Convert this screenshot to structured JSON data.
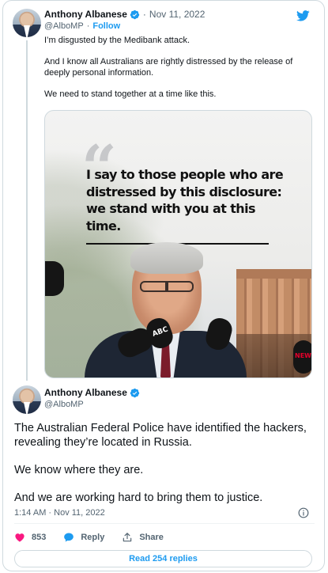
{
  "colors": {
    "accent": "#1d9bf0",
    "text": "#0f1419",
    "muted": "#536471",
    "like": "#f91880",
    "border": "#cfd9de"
  },
  "parent_tweet": {
    "author_name": "Anthony Albanese",
    "handle": "@AlboMP",
    "date": "Nov 11, 2022",
    "separator": "·",
    "follow_label": "Follow",
    "paragraphs": [
      "I’m disgusted by the Medibank attack.",
      "And I know all Australians are rightly distressed by the release of deeply personal information.",
      "We need to stand together at a time like this."
    ],
    "media": {
      "quote_mark": "“",
      "quote_text": "I say to those people who are distressed by this disclosure: we stand with you at this time.",
      "mic_labels": [
        "ABC",
        "NEWS"
      ]
    }
  },
  "main_tweet": {
    "author_name": "Anthony Albanese",
    "handle": "@AlboMP",
    "paragraphs": [
      "The Australian Federal Police have identified the hackers, revealing they’re located in Russia.",
      "We know where they are.",
      "And we are working hard to bring them to justice."
    ],
    "timestamp": "1:14 AM · Nov 11, 2022",
    "actions": {
      "likes_count": "853",
      "reply_label": "Reply",
      "share_label": "Share"
    },
    "read_replies_label": "Read 254 replies"
  },
  "icons": {
    "brand": "twitter-bird-icon",
    "verified": "verified-badge-icon",
    "info": "info-icon",
    "like": "heart-icon",
    "reply": "reply-bubble-icon",
    "share": "share-icon"
  }
}
